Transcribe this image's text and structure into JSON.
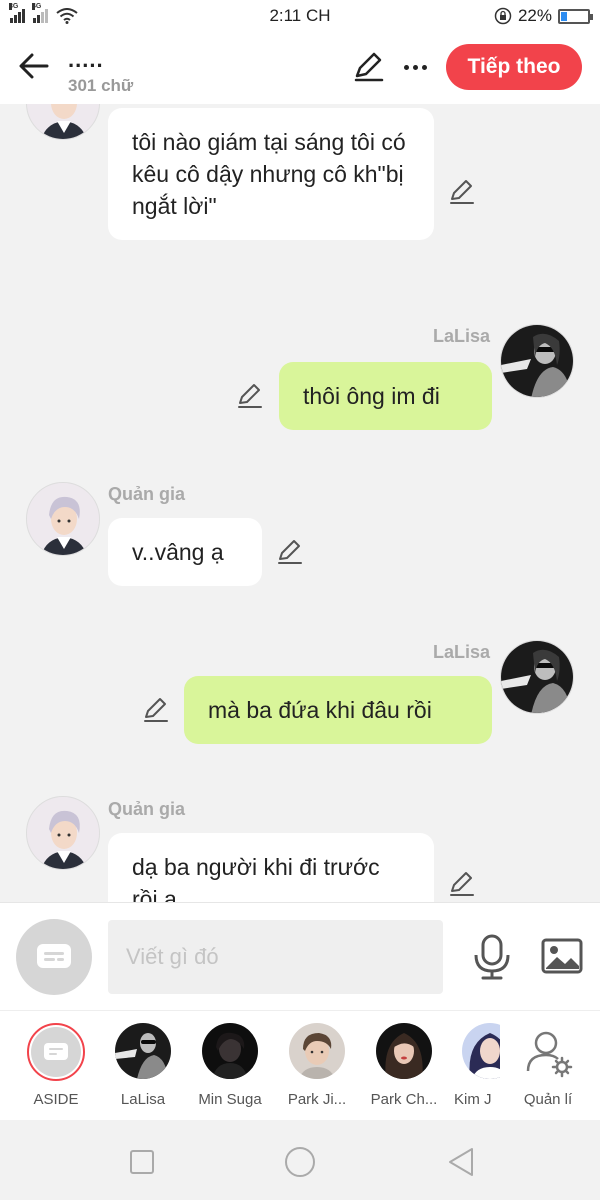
{
  "status_bar": {
    "network_left": "3G",
    "network_right": "4G",
    "time": "2:11 CH",
    "battery_percent": "22%",
    "battery_level": 0.22
  },
  "header": {
    "title": ".....",
    "word_count": "301 chữ",
    "next_label": "Tiếp theo"
  },
  "messages": [
    {
      "side": "left",
      "sender": "",
      "text": "tôi nào giám tại sáng tôi có kêu cô dậy nhưng cô kh\"bị ngắt lời\""
    },
    {
      "side": "right",
      "sender": "LaLisa",
      "text": "thôi ông im đi"
    },
    {
      "side": "left",
      "sender": "Quản gia",
      "text": "v..vâng ạ"
    },
    {
      "side": "right",
      "sender": "LaLisa",
      "text": "mà ba đứa khi đâu rồi"
    },
    {
      "side": "left",
      "sender": "Quản gia",
      "text": "dạ ba người khi đi trước rồi ạ"
    }
  ],
  "composer": {
    "placeholder": "Viết gì đó"
  },
  "characters": [
    {
      "name": "ASIDE"
    },
    {
      "name": "LaLisa"
    },
    {
      "name": "Min Suga"
    },
    {
      "name": "Park Ji..."
    },
    {
      "name": "Park Ch..."
    },
    {
      "name": "Kim J"
    },
    {
      "name": "Quản lí"
    }
  ],
  "colors": {
    "accent": "#f2434b",
    "bubble_right": "#d9f59a",
    "bubble_left": "#ffffff"
  },
  "icons": {
    "back": "arrow-left-icon",
    "edit": "pencil-icon",
    "more": "more-dots-icon",
    "aside": "chat-bubble-icon",
    "mic": "microphone-icon",
    "image": "image-icon",
    "manage": "user-gear-icon"
  }
}
